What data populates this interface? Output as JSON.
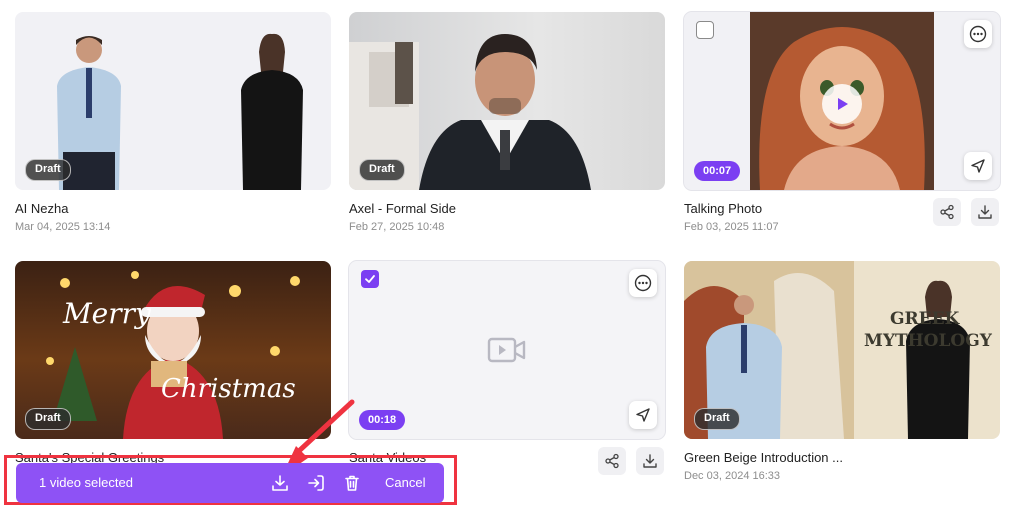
{
  "videos": [
    {
      "title": "AI Nezha",
      "date": "Mar 04, 2025 13:14",
      "badge": "Draft"
    },
    {
      "title": "Axel - Formal Side",
      "date": "Feb 27, 2025 10:48",
      "badge": "Draft"
    },
    {
      "title": "Talking Photo",
      "date": "Feb 03, 2025 11:07",
      "badge": "00:07"
    },
    {
      "title": "Santa's Special Greetings",
      "date": "",
      "badge": "Draft",
      "overlay_text": [
        "Merry",
        "Christmas"
      ]
    },
    {
      "title": "Santa Videos",
      "date": "",
      "badge": "00:18"
    },
    {
      "title": "Green Beige Introduction ...",
      "date": "Dec 03, 2024 16:33",
      "badge": "Draft",
      "overlay_text": [
        "GREEK",
        "MYTHOLOGY"
      ]
    }
  ],
  "selection_bar": {
    "count_label": "1 video selected",
    "cancel_label": "Cancel"
  },
  "colors": {
    "accent": "#7b3ff2",
    "bar": "#8e52f5",
    "annotation": "#ef3340"
  },
  "icons": [
    "more-icon",
    "send-icon",
    "play-icon",
    "share-icon",
    "download-icon",
    "move-icon",
    "trash-icon",
    "video-placeholder-icon",
    "check-icon"
  ]
}
